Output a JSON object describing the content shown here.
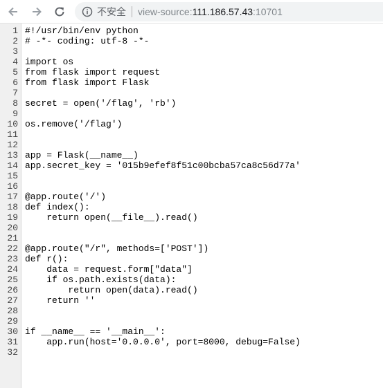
{
  "browser": {
    "insecure_label": "不安全",
    "url_scheme": "view-source:",
    "url_host": "111.186.57.43",
    "url_port": ":10701"
  },
  "source_lines": [
    "#!/usr/bin/env python",
    "# -*- coding: utf-8 -*-",
    "",
    "import os",
    "from flask import request",
    "from flask import Flask",
    "",
    "secret = open('/flag', 'rb')",
    "",
    "os.remove('/flag')",
    "",
    "",
    "app = Flask(__name__)",
    "app.secret_key = '015b9efef8f51c00bcba57ca8c56d77a'",
    "",
    "",
    "@app.route('/')",
    "def index():",
    "    return open(__file__).read()",
    "",
    "",
    "@app.route(\"/r\", methods=['POST'])",
    "def r():",
    "    data = request.form[\"data\"]",
    "    if os.path.exists(data):",
    "        return open(data).read()",
    "    return ''",
    "",
    "",
    "if __name__ == '__main__':",
    "    app.run(host='0.0.0.0', port=8000, debug=False)",
    ""
  ]
}
